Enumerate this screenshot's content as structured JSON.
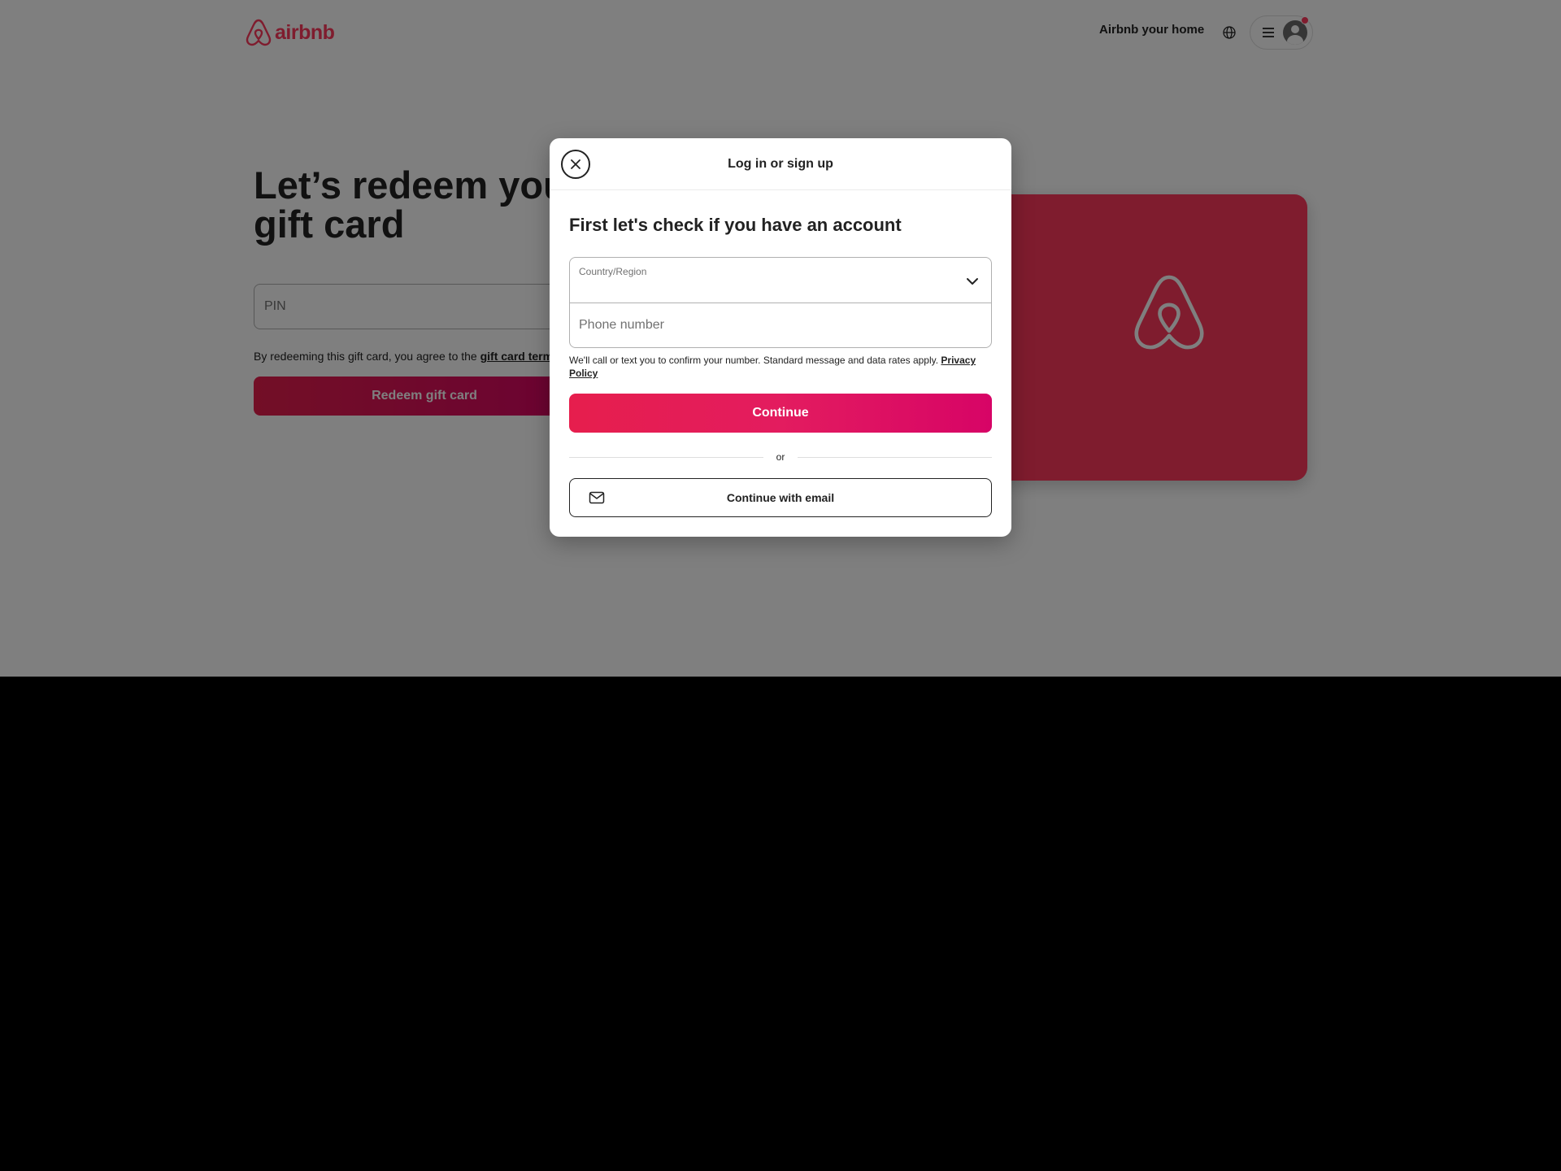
{
  "header": {
    "logo_text": "airbnb",
    "host_link": "Airbnb your home",
    "globe_icon": "globe-icon",
    "menu_icon": "hamburger-menu-icon",
    "avatar_icon": "user-avatar-icon"
  },
  "page": {
    "title_line1": "Let’s redeem your",
    "title_line2": "gift card",
    "pin_placeholder": "PIN",
    "terms_prefix": "By redeeming this gift card, you agree to the ",
    "terms_link": "gift card terms",
    "redeem_button": "Redeem gift card"
  },
  "modal": {
    "title": "Log in or sign up",
    "heading": "First let's check if you have an account",
    "country_label": "Country/Region",
    "country_value": "",
    "phone_placeholder": "Phone number",
    "disclaimer": "We'll call or text you to confirm your number. Standard message and data rates apply. ",
    "privacy_link": "Privacy Policy",
    "continue_button": "Continue",
    "divider_text": "or",
    "email_button": "Continue with email"
  },
  "colors": {
    "brand": "#ff385c",
    "button_gradient_start": "#e61e4d",
    "button_gradient_end": "#d70466",
    "overlay": "rgba(0,0,0,0.5)",
    "text": "#222222"
  }
}
